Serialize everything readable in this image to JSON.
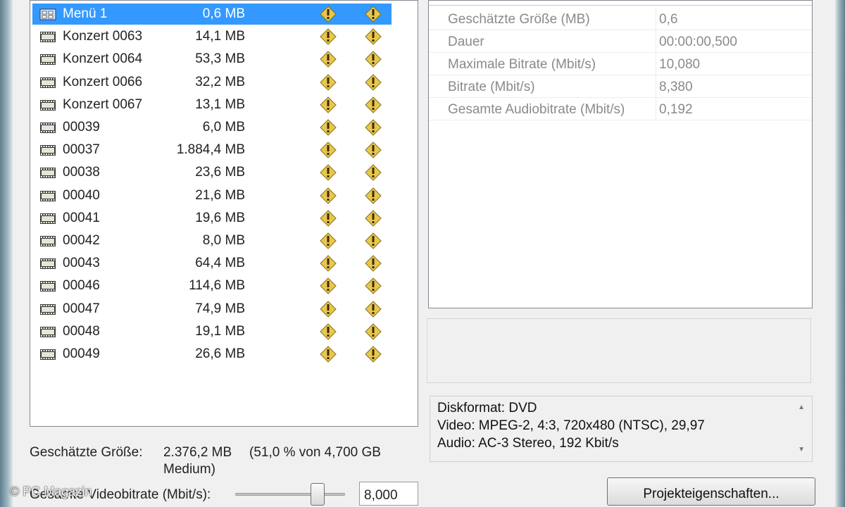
{
  "file_list": {
    "items": [
      {
        "name": "Menü 1",
        "size": "0,6 MB",
        "type": "menu",
        "selected": true
      },
      {
        "name": "Konzert 0063",
        "size": "14,1 MB",
        "type": "video"
      },
      {
        "name": "Konzert 0064",
        "size": "53,3 MB",
        "type": "video"
      },
      {
        "name": "Konzert 0066",
        "size": "32,2 MB",
        "type": "video"
      },
      {
        "name": "Konzert 0067",
        "size": "13,1 MB",
        "type": "video"
      },
      {
        "name": "00039",
        "size": "6,0 MB",
        "type": "video"
      },
      {
        "name": "00037",
        "size": "1.884,4 MB",
        "type": "video"
      },
      {
        "name": "00038",
        "size": "23,6 MB",
        "type": "video"
      },
      {
        "name": "00040",
        "size": "21,6 MB",
        "type": "video"
      },
      {
        "name": "00041",
        "size": "19,6 MB",
        "type": "video"
      },
      {
        "name": "00042",
        "size": "8,0 MB",
        "type": "video"
      },
      {
        "name": "00043",
        "size": "64,4 MB",
        "type": "video"
      },
      {
        "name": "00046",
        "size": "114,6 MB",
        "type": "video"
      },
      {
        "name": "00047",
        "size": "74,9 MB",
        "type": "video"
      },
      {
        "name": "00048",
        "size": "19,1 MB",
        "type": "video"
      },
      {
        "name": "00049",
        "size": "26,6 MB",
        "type": "video"
      }
    ],
    "status_icon": "warning-icon"
  },
  "properties": [
    {
      "key": "Geschätzte Größe (MB)",
      "value": "0,6"
    },
    {
      "key": "Dauer",
      "value": "00:00:00,500"
    },
    {
      "key": "Maximale Bitrate (Mbit/s)",
      "value": "10,080"
    },
    {
      "key": "Bitrate (Mbit/s)",
      "value": "8,380"
    },
    {
      "key": "Gesamte Audiobitrate (Mbit/s)",
      "value": "0,192"
    }
  ],
  "disc_info": {
    "format": "Diskformat:  DVD",
    "video": "Video:  MPEG-2, 4:3, 720x480 (NTSC), 29,97",
    "audio": "Audio:  AC-3 Stereo, 192 Kbit/s"
  },
  "estimate": {
    "label": "Geschätzte Größe:",
    "value": "2.376,2 MB",
    "percent": "(51,0 % von 4,700 GB",
    "medium": "Medium)"
  },
  "bitrate": {
    "label": "Gesamte Videobitrate (Mbit/s):",
    "value": "8,000",
    "slider_fraction": 0.75
  },
  "buttons": {
    "project_properties": "Projekteigenschaften..."
  },
  "watermark": "© PC Magazin",
  "colors": {
    "selection": "#3399ff",
    "warning": "#e8c84a"
  }
}
